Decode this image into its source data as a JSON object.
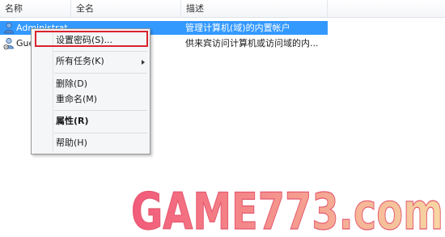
{
  "columns": {
    "name": "名称",
    "fullname": "全名",
    "description": "描述"
  },
  "rows": [
    {
      "name": "Administrat",
      "description": "管理计算机(域)的内置帐户",
      "selected": true
    },
    {
      "name": "Gue",
      "description": "供来宾访问计算机或访问域的内...",
      "selected": false
    }
  ],
  "context_menu": {
    "items": [
      {
        "label": "设置密码(S)..."
      },
      {
        "label": "所有任务(K)"
      },
      {
        "label": "删除(D)"
      },
      {
        "label": "重命名(M)"
      },
      {
        "label": "属性(R)"
      },
      {
        "label": "帮助(H)"
      }
    ]
  },
  "watermark": {
    "text": "GAME773.com"
  },
  "colors": {
    "selection": "#3399ff",
    "highlight_border": "#d9232d"
  }
}
